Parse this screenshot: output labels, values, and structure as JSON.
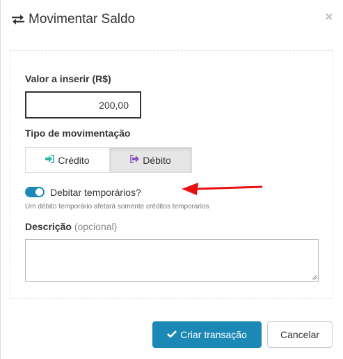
{
  "header": {
    "title": "Movimentar Saldo",
    "title_icon": "exchange-icon",
    "close_symbol": "×"
  },
  "form": {
    "amount_label": "Valor a inserir (R$)",
    "amount_value": "200,00",
    "type_label": "Tipo de movimentação",
    "type_options": [
      {
        "label": "Crédito",
        "icon": "sign-in-icon",
        "selected": false
      },
      {
        "label": "Débito",
        "icon": "sign-out-icon",
        "selected": true
      }
    ],
    "temporary_toggle": {
      "label": "Debitar temporários?",
      "checked": true,
      "hint": "Um débito temporário afetará somente créditos temporarios"
    },
    "description_label": "Descrição",
    "description_optional": "(opcional)",
    "description_value": ""
  },
  "footer": {
    "submit_label": "Criar transação",
    "cancel_label": "Cancelar"
  },
  "colors": {
    "primary": "#1b88b6",
    "credit_icon": "#2bb5a3",
    "debit_icon": "#8a57c0",
    "annotation_arrow": "#e81010"
  }
}
